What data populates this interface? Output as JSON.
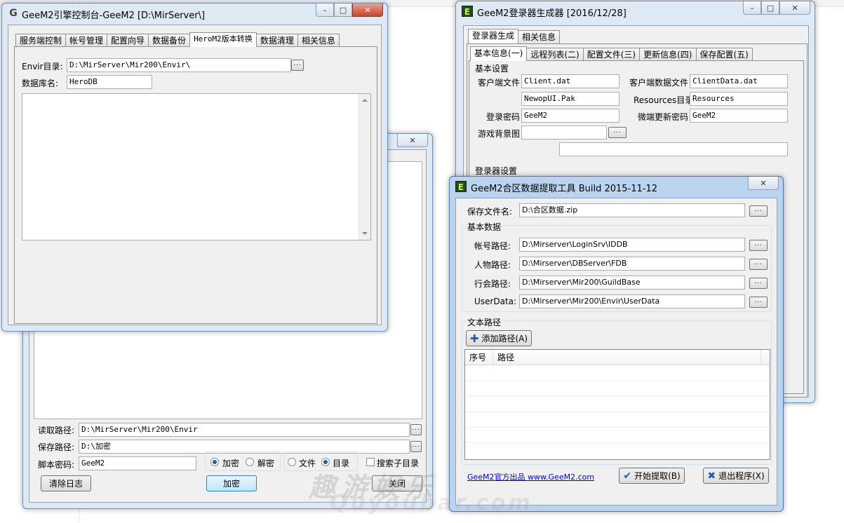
{
  "console": {
    "title": "GeeM2引擎控制台-GeeM2 [D:\\MirServer\\]",
    "tabs": [
      "服务端控制",
      "帐号管理",
      "配置向导",
      "数据备份",
      "HeroM2版本转换",
      "数据清理",
      "相关信息"
    ],
    "selected_tab": 4,
    "envir_label": "Envir目录:",
    "envir_value": "D:\\MirServer\\Mir200\\Envir\\",
    "db_label": "数据库名:",
    "db_value": "HeroDB",
    "browse_label": "..."
  },
  "encryptor": {
    "read_label": "读取路径:",
    "read_value": "D:\\MirServer\\Mir200\\Envir",
    "save_label": "保存路径:",
    "save_value": "D:\\加密",
    "script_pwd_label": "脚本密码:",
    "script_pwd_value": "GeeM2",
    "radio_encrypt": "加密",
    "radio_decrypt": "解密",
    "radio_file": "文件",
    "radio_dir": "目录",
    "check_label": "搜索子目录",
    "clear_log_button": "清除日志",
    "encrypt_button": "加密",
    "close_button": "关闭"
  },
  "login_gen": {
    "title": "GeeM2登录器生成器 [2016/12/28]",
    "outer_tabs": [
      "登录器生成",
      "相关信息"
    ],
    "inner_tabs": [
      "基本信息(一)",
      "远程列表(二)",
      "配置文件(三)",
      "更新信息(四)",
      "保存配置(五)"
    ],
    "basic_group": "基本设置",
    "client_file_label": "客户端文件",
    "client_file_value": "Client.dat",
    "client_data_label": "客户端数据文件",
    "client_data_value": "ClientData.dat",
    "ui_value": "NewopUI.Pak",
    "resources_label": "Resources目录",
    "resources_value": "Resources",
    "login_pwd_label": "登录密码",
    "login_pwd_value": "GeeM2",
    "micro_pwd_label": "微端更新密码",
    "micro_pwd_value": "GeeM2",
    "bg_label": "游戏背景图",
    "login_group": "登录器设置"
  },
  "merge": {
    "title": "GeeM2合区数据提取工具 Build 2015-11-12",
    "save_file_label": "保存文件名:",
    "save_file_value": "D:\\合区数据.zip",
    "basic_group": "基本数据",
    "account_label": "帐号路径:",
    "account_value": "D:\\Mirserver\\LoginSrv\\IDDB",
    "char_label": "人物路径:",
    "char_value": "D:\\Mirserver\\DBServer\\FDB",
    "guild_label": "行会路径:",
    "guild_value": "D:\\Mirserver\\Mir200\\GuildBase",
    "userdata_label": "UserData:",
    "userdata_value": "D:\\Mirserver\\Mir200\\Envir\\UserData",
    "text_group": "文本路径",
    "add_path_button": "添加路径(A)",
    "col_no": "序号",
    "col_path": "路径",
    "official_link": "GeeM2官方出品 www.GeeM2.com",
    "start_button": "开始提取(B)",
    "exit_button": "退出程序(X)"
  },
  "icons": {
    "app_g": "G",
    "app_e": "E",
    "min": "–",
    "max": "□",
    "close": "✕",
    "plus": "✚",
    "check": "✔",
    "x": "✖"
  },
  "watermark": {
    "line1": "趣游娱乐",
    "line2": "Quyoubar.com"
  }
}
